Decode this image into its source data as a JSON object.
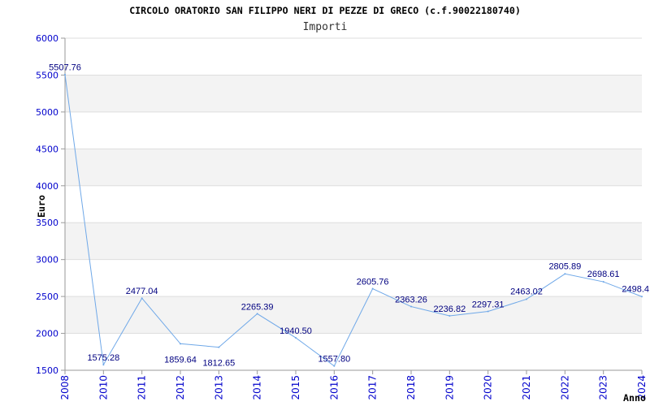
{
  "colors": {
    "background": "#ffffff",
    "band": "#f3f3f3",
    "grid": "#dedede",
    "axis": "#9a9a9a",
    "line": "#6fa8e8",
    "tick_label": "#0000cc",
    "data_label": "#000080",
    "title": "#000000",
    "subtitle": "#333333"
  },
  "chart_data": {
    "type": "line",
    "title": "CIRCOLO ORATORIO SAN FILIPPO NERI DI PEZZE DI GRECO (c.f.90022180740)",
    "subtitle": "Importi",
    "xlabel": "Anno",
    "ylabel": "Euro",
    "categories": [
      "2008",
      "2010",
      "2011",
      "2012",
      "2013",
      "2014",
      "2015",
      "2016",
      "2017",
      "2018",
      "2019",
      "2020",
      "2021",
      "2022",
      "2023",
      "2024"
    ],
    "values": [
      5507.76,
      1575.28,
      2477.04,
      1859.64,
      1812.65,
      2265.39,
      1940.5,
      1557.8,
      2605.76,
      2363.26,
      2236.82,
      2297.31,
      2463.02,
      2805.89,
      2698.61,
      2498.4
    ],
    "value_labels": [
      "5507.76",
      "1575.28",
      "2477.04",
      "1859.64",
      "1812.65",
      "2265.39",
      "1940.50",
      "1557.80",
      "2605.76",
      "2363.26",
      "2236.82",
      "2297.31",
      "2463.02",
      "2805.89",
      "2698.61",
      "2498.4"
    ],
    "y_ticks": [
      1500,
      2000,
      2500,
      3000,
      3500,
      4000,
      4500,
      5000,
      5500,
      6000
    ],
    "ylim": [
      1500,
      6000
    ],
    "grid": true,
    "banded_background": true,
    "legend": "none"
  }
}
